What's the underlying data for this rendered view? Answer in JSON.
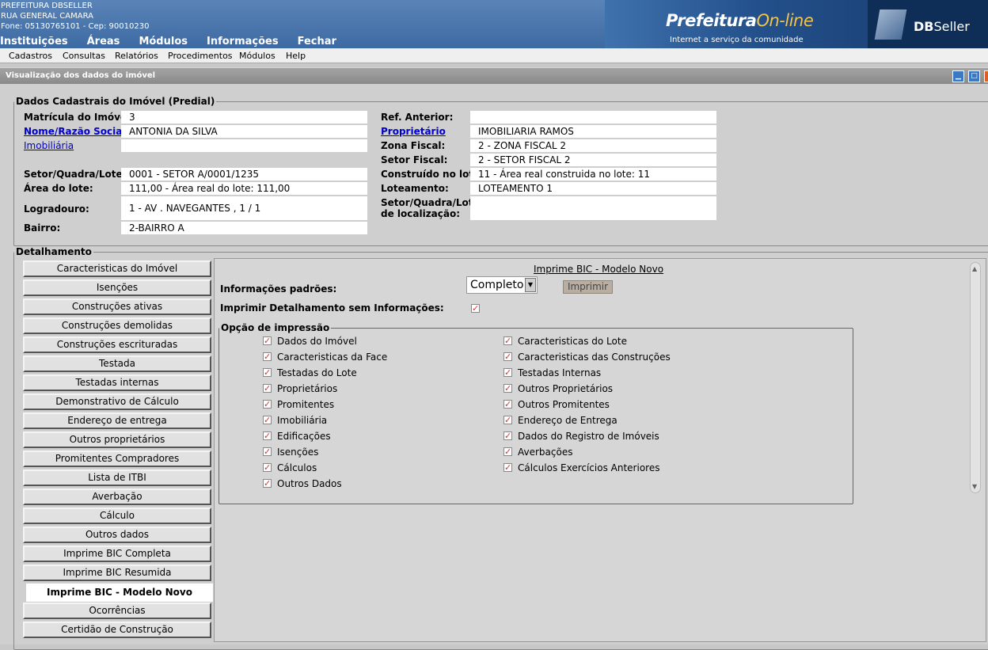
{
  "header": {
    "org": "PREFEITURA DBSELLER",
    "address": "RUA GENERAL CAMARA",
    "phone": "Fone: 05130765101  -  Cep: 90010230",
    "menu": [
      "Instituições",
      "Áreas",
      "Módulos",
      "Informações",
      "Fechar"
    ],
    "logo_main": "Prefeitura",
    "logo_online": "On-line",
    "logo_tagline": "Internet a serviço da comunidade",
    "brand_db": "DB",
    "brand_seller": "Seller"
  },
  "submenu": [
    "Cadastros",
    "Consultas",
    "Relatórios",
    "Procedimentos",
    "Módulos",
    "Help"
  ],
  "window": {
    "title": "Visualização dos dados do imóvel"
  },
  "dados": {
    "legend": "Dados Cadastrais do Imóvel (Predial)",
    "matricula_label": "Matrícula do Imóvel:",
    "matricula": "3",
    "nome_label": "Nome/Razão Social:",
    "nome": "ANTONIA DA SILVA",
    "imobiliaria_label": "Imobiliária",
    "imobiliaria": "",
    "setor_label": "Setor/Quadra/Lote:",
    "setor": "0001 - SETOR A/0001/1235",
    "area_label": "Área do lote:",
    "area": "111,00 - Área real do lote: 111,00",
    "logradouro_label": "Logradouro:",
    "logradouro": "1 - AV . NAVEGANTES , 1 / 1",
    "bairro_label": "Bairro:",
    "bairro": "2-BAIRRO A",
    "ref_label": "Ref. Anterior:",
    "ref": "",
    "proprietario_label": "Proprietário",
    "proprietario": "IMOBILIARIA RAMOS",
    "zona_label": "Zona Fiscal:",
    "zona": "2 - ZONA FISCAL 2",
    "setor_fiscal_label": "Setor Fiscal:",
    "setor_fiscal": "2 - SETOR FISCAL 2",
    "construido_label": "Construído no lote:",
    "construido": "11 - Área real construida no lote: 11",
    "loteamento_label": "Loteamento:",
    "loteamento": "LOTEAMENTO 1",
    "sql_loc_label_1": "Setor/Quadra/Lote",
    "sql_loc_label_2": "de localização:",
    "sql_loc": ""
  },
  "detalhamento": {
    "legend": "Detalhamento",
    "nav": [
      "Caracteristicas do Imóvel",
      "Isenções",
      "Construções ativas",
      "Construções demolidas",
      "Construções escrituradas",
      "Testada",
      "Testadas internas",
      "Demonstrativo de Cálculo",
      "Endereço de entrega",
      "Outros proprietários",
      "Promitentes Compradores",
      "Lista de ITBI",
      "Averbação",
      "Cálculo",
      "Outros dados",
      "Imprime BIC Completa",
      "Imprime BIC Resumida",
      "Imprime BIC - Modelo Novo",
      "Ocorrências",
      "Certidão de Construção"
    ],
    "active": "Imprime BIC - Modelo Novo"
  },
  "panel": {
    "title": "Imprime BIC - Modelo Novo",
    "info_label": "Informações padrões:",
    "select_value": "Completo",
    "print_button": "Imprimir",
    "detail_label": "Imprimir Detalhamento sem Informações:",
    "detail_checked": true,
    "options_legend": "Opção de impressão",
    "options_left": [
      "Dados do Imóvel",
      "Caracteristicas da Face",
      "Testadas do Lote",
      "Proprietários",
      "Promitentes",
      "Imobiliária",
      "Edificações",
      "Isenções",
      "Cálculos",
      "Outros Dados"
    ],
    "options_right": [
      "Caracteristicas do Lote",
      "Caracteristicas das Construções",
      "Testadas Internas",
      "Outros Proprietários",
      "Outros Promitentes",
      "Endereço de Entrega",
      "Dados do Registro de Imóveis",
      "Averbações",
      "Cálculos Exercícios Anteriores"
    ]
  },
  "colors": {
    "header_blue": "#3d6aa3",
    "link": "#0000cc",
    "check": "#dd3333"
  }
}
